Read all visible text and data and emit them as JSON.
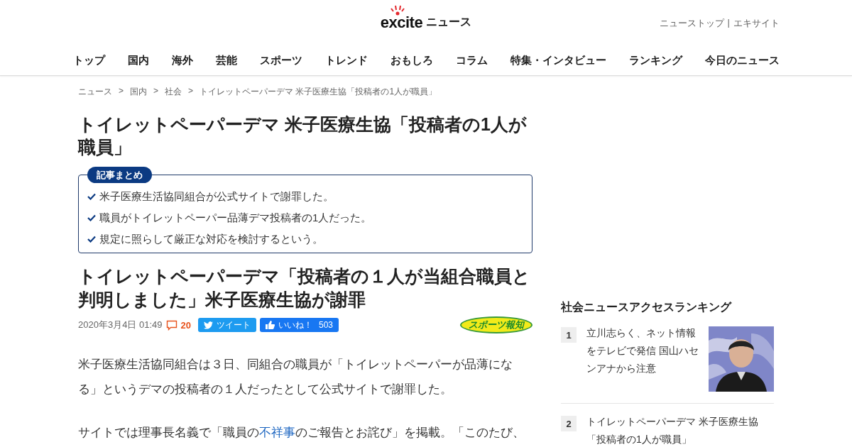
{
  "header": {
    "logo": "excite",
    "logo_suffix": "ニュース",
    "links": [
      {
        "label": "ニューストップ"
      },
      {
        "label": "エキサイト"
      }
    ],
    "separator": "|"
  },
  "nav": [
    {
      "label": "トップ"
    },
    {
      "label": "国内"
    },
    {
      "label": "海外"
    },
    {
      "label": "芸能"
    },
    {
      "label": "スポーツ"
    },
    {
      "label": "トレンド"
    },
    {
      "label": "おもしろ"
    },
    {
      "label": "コラム"
    },
    {
      "label": "特集・インタビュー"
    },
    {
      "label": "ランキング"
    },
    {
      "label": "今日のニュース"
    }
  ],
  "breadcrumb": {
    "separator": ">",
    "items": [
      "ニュース",
      "国内",
      "社会",
      "トイレットペーパーデマ 米子医療生協「投稿者の1人が職員」"
    ]
  },
  "headline": "トイレットペーパーデマ 米子医療生協「投稿者の1人が職員」",
  "summary": {
    "label": "記事まとめ",
    "items": [
      "米子医療生活協同組合が公式サイトで謝罪した。",
      "職員がトイレットペーパー品薄デマ投稿者の1人だった。",
      "規定に照らして厳正な対応を検討するという。"
    ]
  },
  "article": {
    "title": "トイレットペーパーデマ「投稿者の１人が当組合職員と判明しました」米子医療生協が謝罪",
    "date": "2020年3月4日 01:49",
    "comments": "20",
    "tweet": "ツイート",
    "like": "いいね！",
    "like_count": "503",
    "source": "スポーツ報知",
    "paragraphs": [
      [
        {
          "kind": "text",
          "text": "米子医療生活協同組合は３日、同組合の職員が「トイレットペーパーが品薄になる」というデマの投稿者の１人だったとして公式サイトで謝罪した。"
        }
      ],
      [
        {
          "kind": "text",
          "text": "サイトでは理事長名義で「職員の"
        },
        {
          "kind": "link",
          "text": "不祥事"
        },
        {
          "kind": "text",
          "text": "のご報告とお詫び」を掲載。「このたび、"
        }
      ]
    ]
  },
  "ranking": {
    "title": "社会ニュースアクセスランキング",
    "items": [
      {
        "rank": "1",
        "title": "立川志らく、ネット情報をテレビで発信 国山ハセンアナから注意"
      },
      {
        "rank": "2",
        "title": "トイレットペーパーデマ 米子医療生協「投稿者の1人が職員」"
      }
    ]
  }
}
